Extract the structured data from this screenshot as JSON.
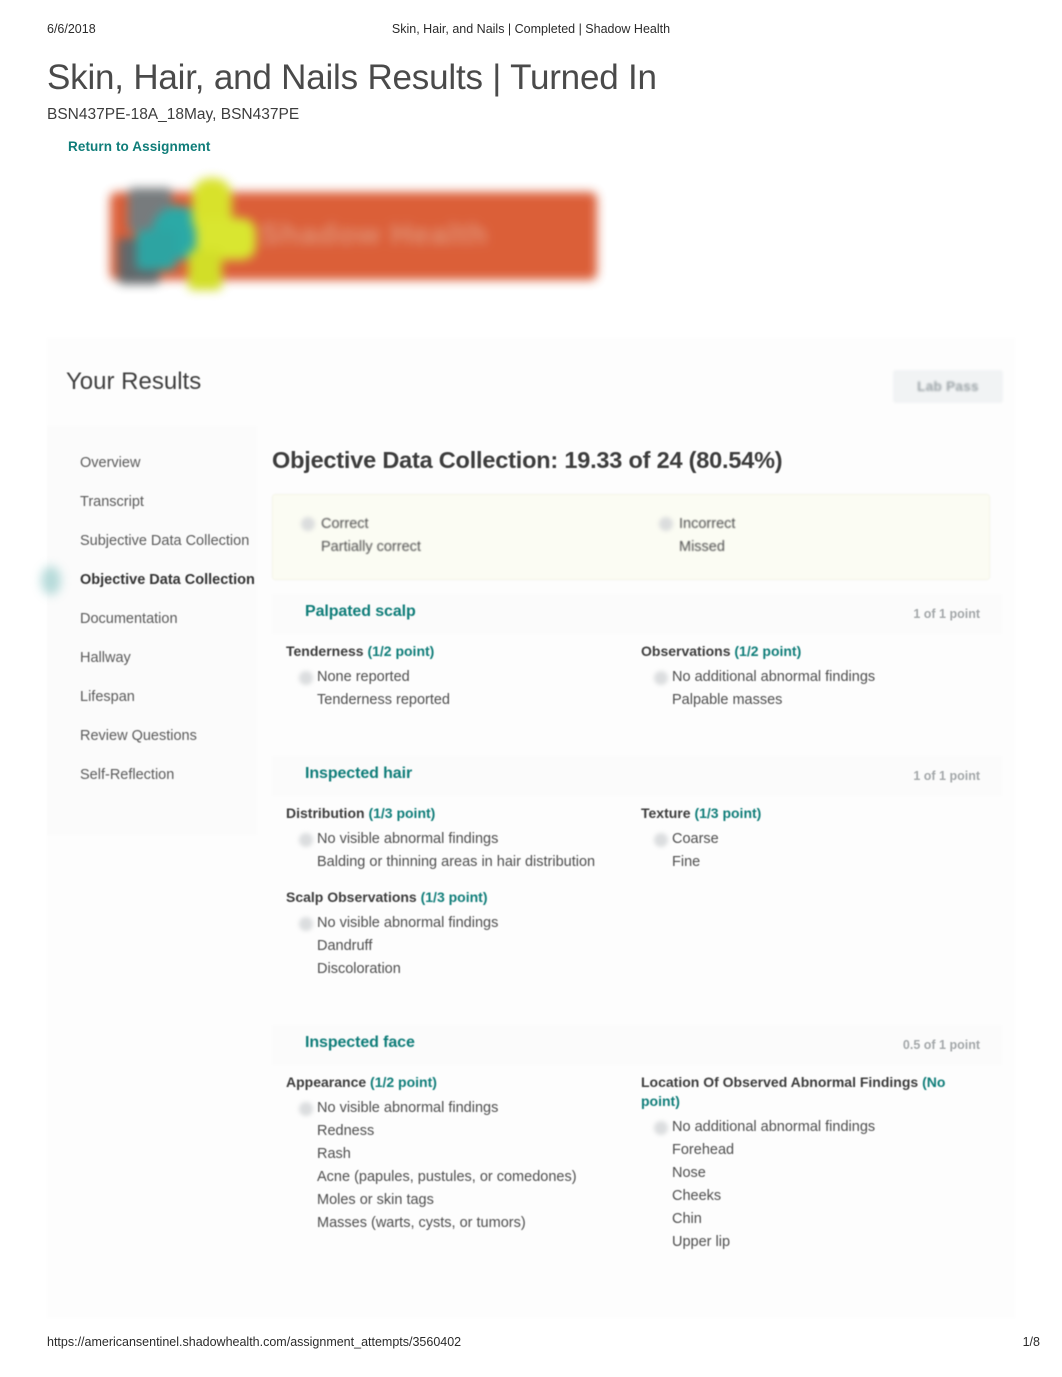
{
  "print_header": {
    "date": "6/6/2018",
    "title": "Skin, Hair, and Nails | Completed | Shadow Health"
  },
  "print_footer": {
    "url": "https://americansentinel.shadowhealth.com/assignment_attempts/3560402",
    "page": "1/8"
  },
  "page": {
    "title": "Skin, Hair, and Nails Results | Turned In",
    "subtitle": "BSN437PE-18A_18May, BSN437PE",
    "return_link": "Return to Assignment"
  },
  "logo": {
    "text": "Shadow Health",
    "bar_color": "#d9532a",
    "teal": "#1ba3a0",
    "yellow": "#d6e01c",
    "gray": "#6d7274"
  },
  "results": {
    "heading": "Your Results",
    "lab_pass_label": "Lab Pass"
  },
  "nav": {
    "items": [
      {
        "label": "Overview",
        "active": false
      },
      {
        "label": "Transcript",
        "active": false
      },
      {
        "label": "Subjective Data Collection",
        "active": false
      },
      {
        "label": "Objective Data Collection",
        "active": true
      },
      {
        "label": "Documentation",
        "active": false
      },
      {
        "label": "Hallway",
        "active": false
      },
      {
        "label": "Lifespan",
        "active": false
      },
      {
        "label": "Review Questions",
        "active": false
      },
      {
        "label": "Self-Reflection",
        "active": false
      }
    ]
  },
  "main": {
    "score_title": "Objective Data Collection: 19.33 of 24 (80.54%)",
    "legend": {
      "left": [
        "Correct",
        "Partially correct"
      ],
      "right": [
        "Incorrect",
        "Missed"
      ]
    },
    "accent_color": "#0f7d79",
    "sections": [
      {
        "title": "Palpated scalp",
        "points": "1 of 1 point",
        "groups": [
          {
            "label": "Tenderness",
            "points": "(1/2 point)",
            "options": [
              "None reported",
              "Tenderness reported"
            ]
          },
          {
            "label": "Observations",
            "points": "(1/2 point)",
            "options": [
              "No additional abnormal findings",
              "Palpable masses"
            ]
          }
        ]
      },
      {
        "title": "Inspected hair",
        "points": "1 of 1 point",
        "groups": [
          {
            "label": "Distribution",
            "points": "(1/3 point)",
            "options": [
              "No visible abnormal findings",
              "Balding or thinning areas in hair distribution"
            ]
          },
          {
            "label": "Texture",
            "points": "(1/3 point)",
            "options": [
              "Coarse",
              "Fine"
            ]
          },
          {
            "label": "Scalp Observations",
            "points": "(1/3 point)",
            "options": [
              "No visible abnormal findings",
              "Dandruff",
              "Discoloration"
            ]
          }
        ]
      },
      {
        "title": "Inspected face",
        "points": "0.5 of 1 point",
        "groups": [
          {
            "label": "Appearance",
            "points": "(1/2 point)",
            "options": [
              "No visible abnormal findings",
              "Redness",
              "Rash",
              "Acne (papules, pustules, or comedones)",
              "Moles or skin tags",
              "Masses (warts, cysts, or tumors)"
            ]
          },
          {
            "label": "Location Of Observed Abnormal Findings",
            "points": "(No point)",
            "options": [
              "No additional abnormal findings",
              "Forehead",
              "Nose",
              "Cheeks",
              "Chin",
              "Upper lip"
            ]
          }
        ]
      }
    ]
  }
}
